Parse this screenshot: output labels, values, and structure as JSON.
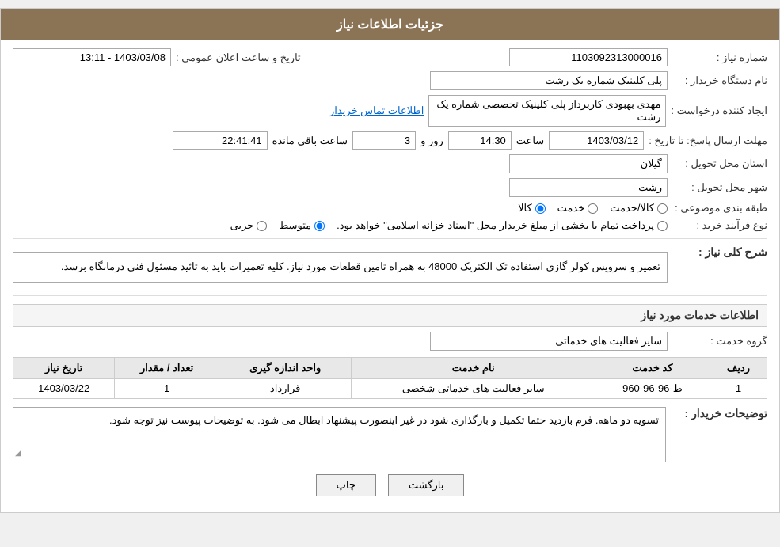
{
  "header": {
    "title": "جزئیات اطلاعات نیاز"
  },
  "fields": {
    "need_number_label": "شماره نیاز :",
    "need_number_value": "1103092313000016",
    "station_label": "نام دستگاه خریدار :",
    "station_value": "پلی کلینیک شماره یک رشت",
    "creator_label": "ایجاد کننده درخواست :",
    "creator_value": "مهدی بهبودی کاربرداز پلی کلینیک تخصصی شماره یک رشت",
    "creator_link": "اطلاعات تماس خریدار",
    "response_time_label": "مهلت ارسال پاسخ: تا تاریخ :",
    "date_value": "1403/03/12",
    "time_label": "ساعت",
    "time_value": "14:30",
    "day_label": "روز و",
    "days_value": "3",
    "remaining_label": "ساعت باقی مانده",
    "remaining_value": "22:41:41",
    "province_label": "استان محل تحویل :",
    "province_value": "گیلان",
    "city_label": "شهر محل تحویل :",
    "city_value": "رشت",
    "category_label": "طبقه بندی موضوعی :",
    "radio_service": "خدمت",
    "radio_goods": "کالا",
    "radio_goods_service": "کالا/خدمت",
    "process_label": "نوع فرآیند خرید :",
    "radio_partial": "جزیی",
    "radio_medium": "متوسط",
    "radio_total_label": "پرداخت تمام یا بخشی از مبلغ خریدار محل \"اسناد خزانه اسلامی\" خواهد بود.",
    "announce_label": "تاریخ و ساعت اعلان عمومی :",
    "announce_value": "1403/03/08 - 13:11"
  },
  "description_section": {
    "title": "شرح کلی نیاز :",
    "content": "تعمیر و سرویس کولر گازی استفاده تک الکتریک 48000 به همراه تامین قطعات مورد نیاز. کلیه تعمیرات باید به تائید مسئول فنی درمانگاه برسد."
  },
  "services_section": {
    "title": "اطلاعات خدمات مورد نیاز",
    "group_label": "گروه خدمت :",
    "group_value": "سایر فعالیت های خدماتی",
    "table": {
      "headers": [
        "ردیف",
        "کد خدمت",
        "نام خدمت",
        "واحد اندازه گیری",
        "تعداد / مقدار",
        "تاریخ نیاز"
      ],
      "rows": [
        {
          "row": "1",
          "code": "ط-96-96-960",
          "name": "سایر فعالیت های خدماتی شخصی",
          "unit": "قرارداد",
          "qty": "1",
          "date": "1403/03/22"
        }
      ]
    }
  },
  "buyer_comments": {
    "label": "توضیحات خریدار :",
    "content": "تسویه دو ماهه. فرم بازدید حتما تکمیل و بارگذاری شود در غیر اینصورت پیشنهاد ابطال می شود. به توضیحات پیوست نیز توجه شود."
  },
  "buttons": {
    "print": "چاپ",
    "back": "بازگشت"
  }
}
